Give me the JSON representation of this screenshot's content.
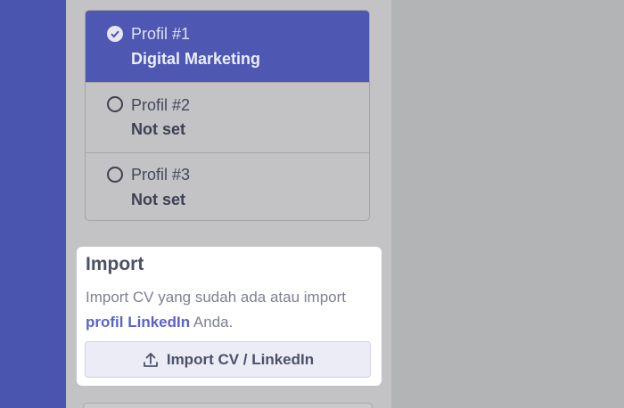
{
  "profiles": [
    {
      "name": "Profil #1",
      "value": "Digital Marketing",
      "selected": true
    },
    {
      "name": "Profil #2",
      "value": "Not set",
      "selected": false
    },
    {
      "name": "Profil #3",
      "value": "Not set",
      "selected": false
    }
  ],
  "import": {
    "title": "Import",
    "desc_prefix": "Import CV yang sudah ada atau import",
    "link_text": "profil LinkedIn",
    "desc_suffix": "Anda.",
    "button_label": "Import CV / LinkedIn",
    "button_icon": "upload-icon"
  },
  "colors": {
    "accent": "#4e57b1",
    "link": "#5b63c9",
    "overlay_bg": "#b3b4b6"
  }
}
